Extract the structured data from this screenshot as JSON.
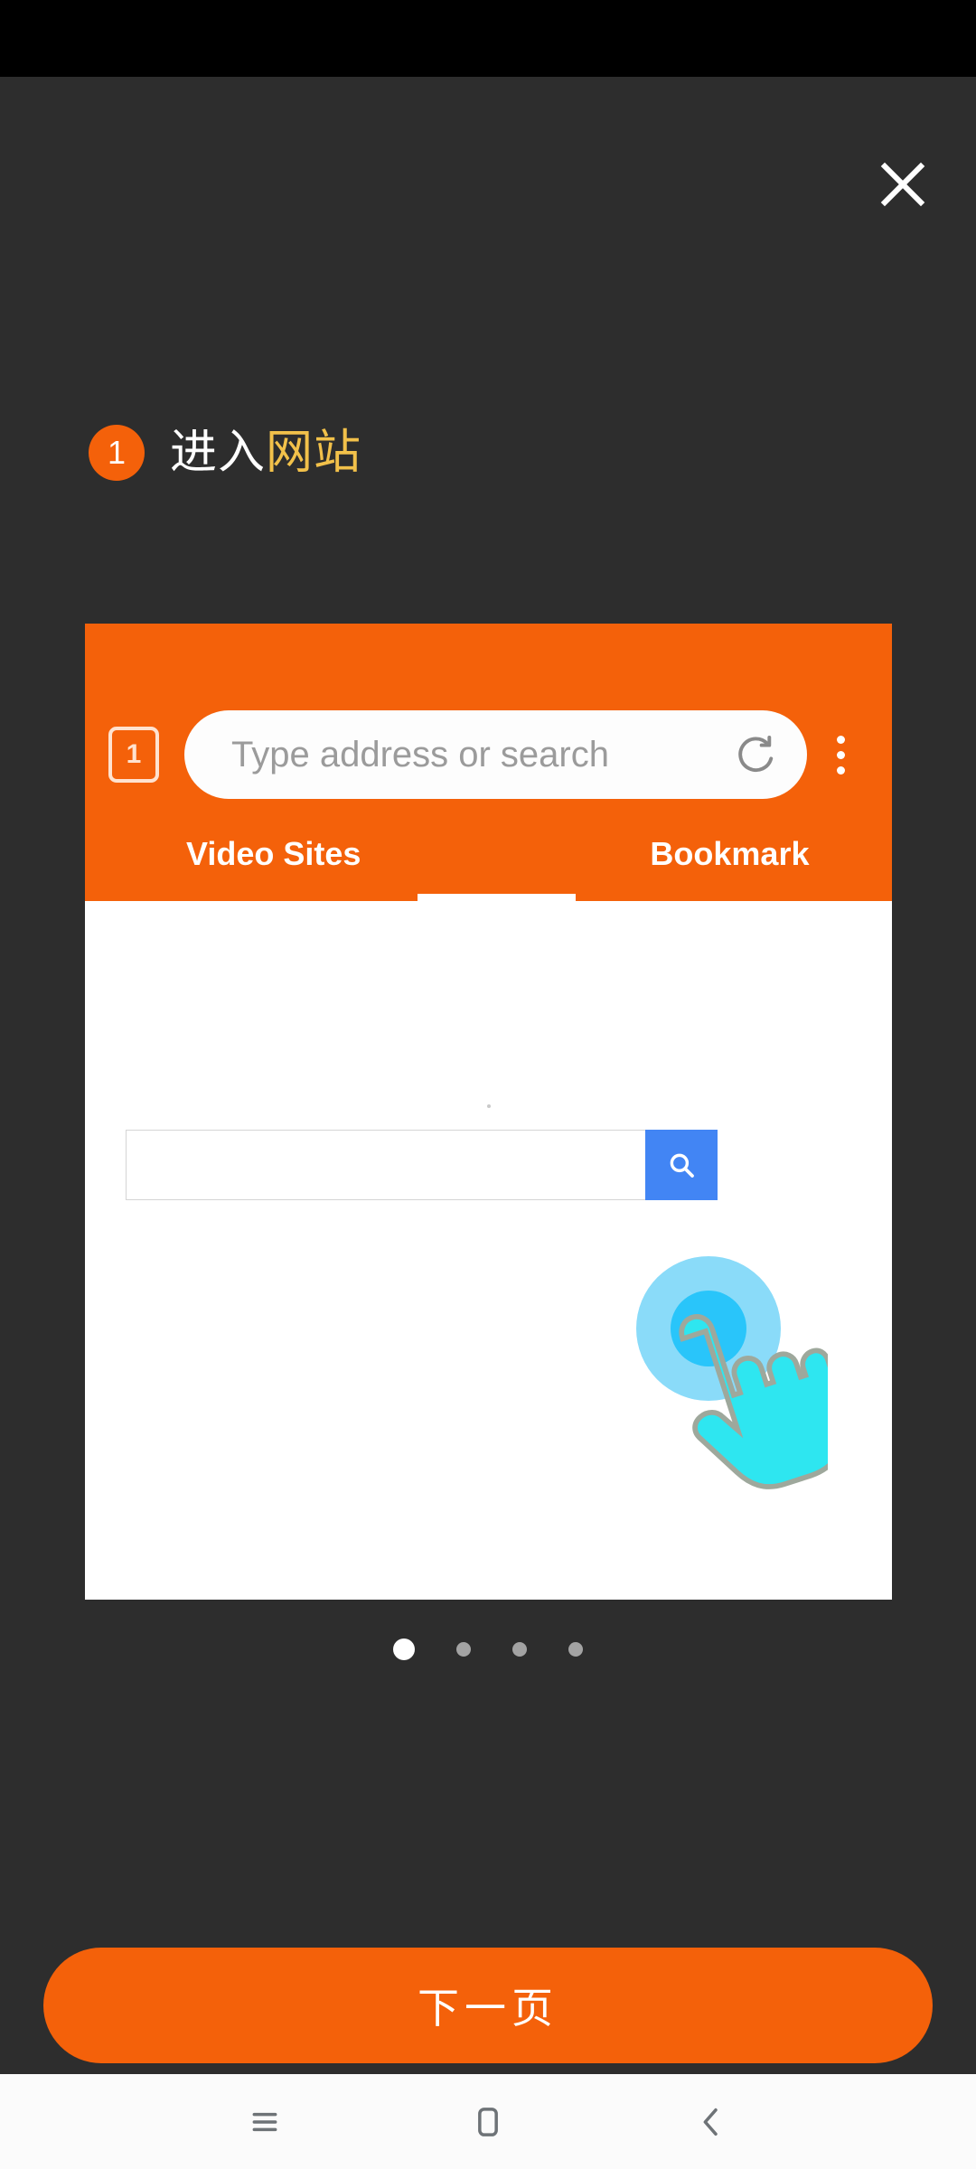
{
  "window": {
    "background_color": "#2d2d2d",
    "accent_color": "#f4610a",
    "highlight_color": "#f2c14a"
  },
  "header": {
    "close_label": "close-icon"
  },
  "step": {
    "number": "1",
    "title_plain": "进入",
    "title_accent": "网站"
  },
  "mock_browser": {
    "tab_count": "1",
    "address_placeholder": "Type address or search",
    "reload_icon": "refresh-icon",
    "menu_icon": "overflow-menu-icon",
    "tabs": [
      {
        "label": "Video Sites",
        "active": true
      },
      {
        "label": "Bookmark",
        "active": false
      }
    ],
    "page": {
      "search_placeholder": "",
      "search_button_icon": "search-icon"
    }
  },
  "carousel": {
    "total": 4,
    "current": 1
  },
  "cta": {
    "label": "下一页"
  },
  "navbar": {
    "buttons": [
      {
        "name": "recents-icon",
        "label": "Recents"
      },
      {
        "name": "home-icon",
        "label": "Home"
      },
      {
        "name": "back-icon",
        "label": "Back"
      }
    ]
  }
}
